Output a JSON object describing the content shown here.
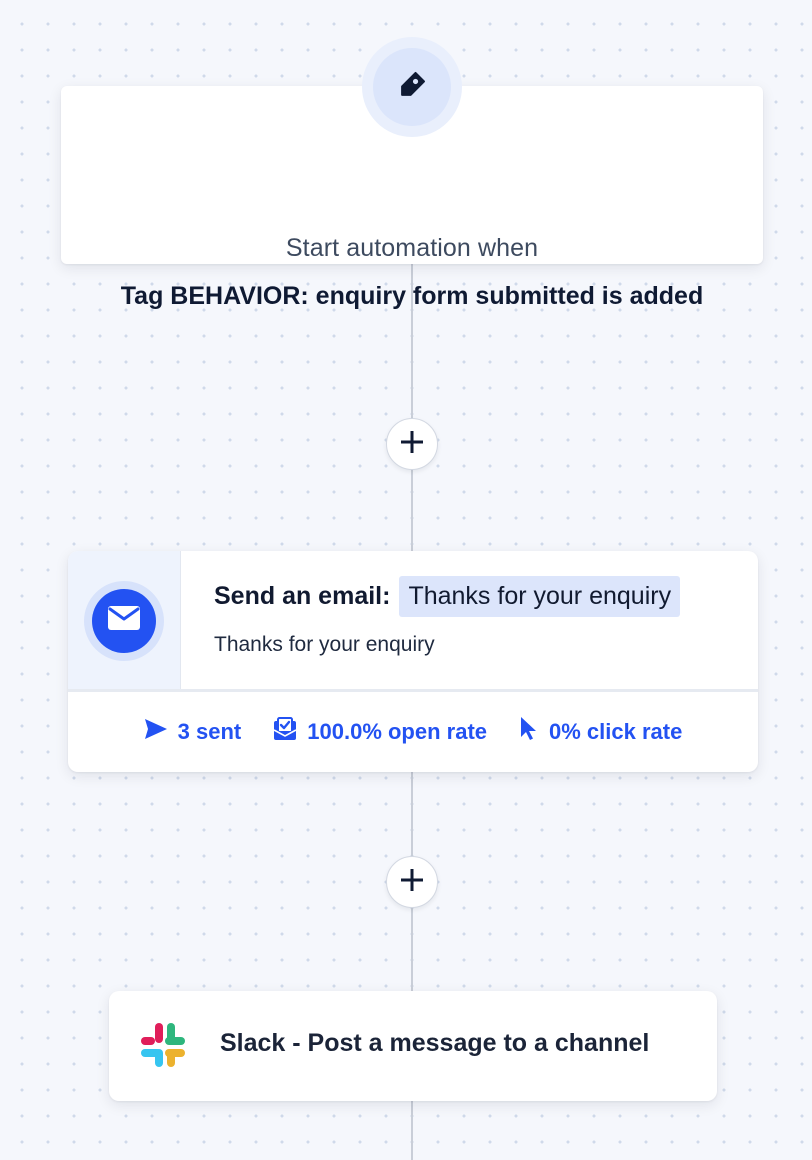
{
  "trigger": {
    "icon": "tag-icon",
    "subtitle": "Start automation when",
    "title": "Tag BEHAVIOR: enquiry form submitted is added"
  },
  "add_step_buttons": [
    {
      "icon": "plus-icon"
    },
    {
      "icon": "plus-icon"
    }
  ],
  "email_step": {
    "icon": "envelope-icon",
    "action_label": "Send an email:",
    "email_name": "Thanks for your enquiry",
    "subject": "Thanks for your enquiry",
    "stats": {
      "sent": {
        "icon": "send-icon",
        "label": "3 sent"
      },
      "open_rate": {
        "icon": "opened-mail-icon",
        "label": "100.0% open rate"
      },
      "click_rate": {
        "icon": "cursor-icon",
        "label": "0% click rate"
      }
    }
  },
  "slack_step": {
    "icon": "slack-logo-icon",
    "label": "Slack - Post a message to a channel"
  },
  "colors": {
    "accent": "#2352f2",
    "canvas_background": "#f5f7fc",
    "dot_grid": "#cfd9ea",
    "connector": "#c9ced8",
    "text_dark": "#0f1a33",
    "pill_background": "#dce5fb"
  }
}
